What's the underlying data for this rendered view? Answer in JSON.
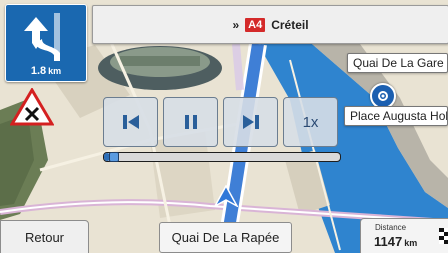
{
  "turn": {
    "icon": "keep-left-lane-arrow-icon",
    "distance_value": "1.8",
    "distance_unit": "km"
  },
  "next_street": {
    "arrows": "»",
    "road_number": "A4",
    "name": "Créteil"
  },
  "map_labels": {
    "top_right": "Quai De La Gare",
    "poi_name": "Place Augusta Holmès"
  },
  "warning": {
    "icon": "no-entry-warning-triangle-icon"
  },
  "player": {
    "speed_label": "1x",
    "progress": 0.02
  },
  "footer": {
    "back_label": "Retour",
    "current_street": "Quai De La Rapée",
    "distance_caption": "Distance",
    "distance_value": "1147",
    "distance_unit": "km"
  },
  "colors": {
    "water": "#2f84cf",
    "route": "#3f7fd6",
    "turn_panel": "#1a68b0",
    "road_shield": "#d42a2a",
    "land": "#e9e3d3"
  }
}
